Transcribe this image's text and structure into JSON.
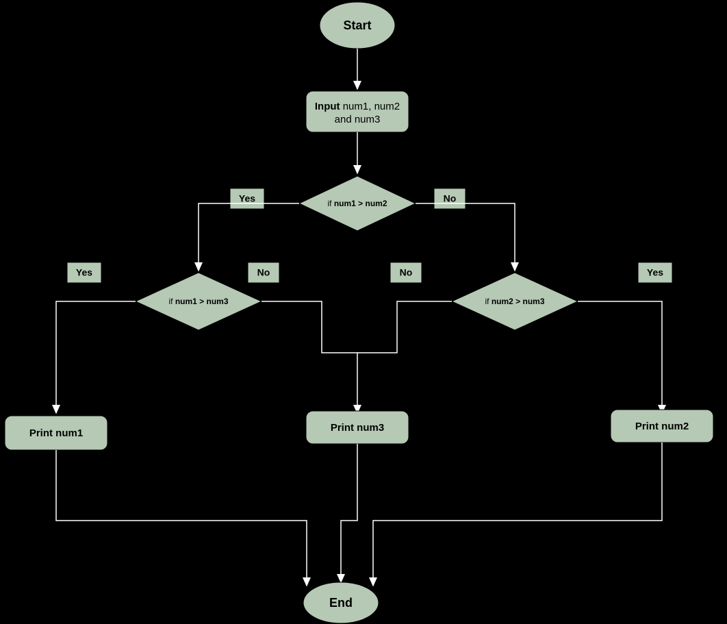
{
  "colors": {
    "node_fill": "#b5c9b5",
    "background": "#000000",
    "connector": "#ffffff"
  },
  "nodes": {
    "start": {
      "label": "Start"
    },
    "input": {
      "line1_bold": "Input",
      "line1_rest": " num1, num2",
      "line2": "and num3"
    },
    "d1": {
      "prefix": "if ",
      "cond": "num1 > num2"
    },
    "d2": {
      "prefix": "if ",
      "cond": "num1 > num3"
    },
    "d3": {
      "prefix": "if ",
      "cond": "num2 > num3"
    },
    "p1": {
      "label": "Print num1"
    },
    "p2": {
      "label": "Print num2"
    },
    "p3": {
      "label": "Print num3"
    },
    "end": {
      "label": "End"
    }
  },
  "labels": {
    "yes": "Yes",
    "no": "No"
  }
}
